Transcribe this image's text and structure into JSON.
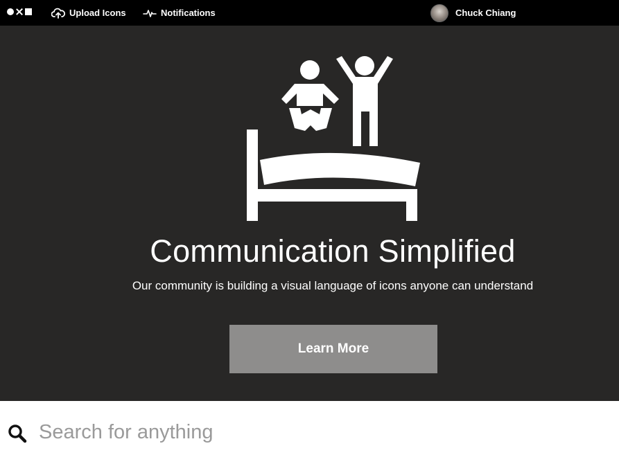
{
  "topbar": {
    "upload_label": "Upload Icons",
    "notifications_label": "Notifications",
    "user_name": "Chuck Chiang"
  },
  "hero": {
    "title": "Communication Simplified",
    "subtitle": "Our community is building a visual language of icons anyone can understand",
    "button_label": "Learn More",
    "icon": "kids-jumping-on-bed-icon"
  },
  "search": {
    "placeholder": "Search for anything"
  },
  "colors": {
    "topbar_bg": "#000000",
    "hero_bg": "#282726",
    "button_bg": "#8e8d8c",
    "text_light": "#ffffff"
  }
}
